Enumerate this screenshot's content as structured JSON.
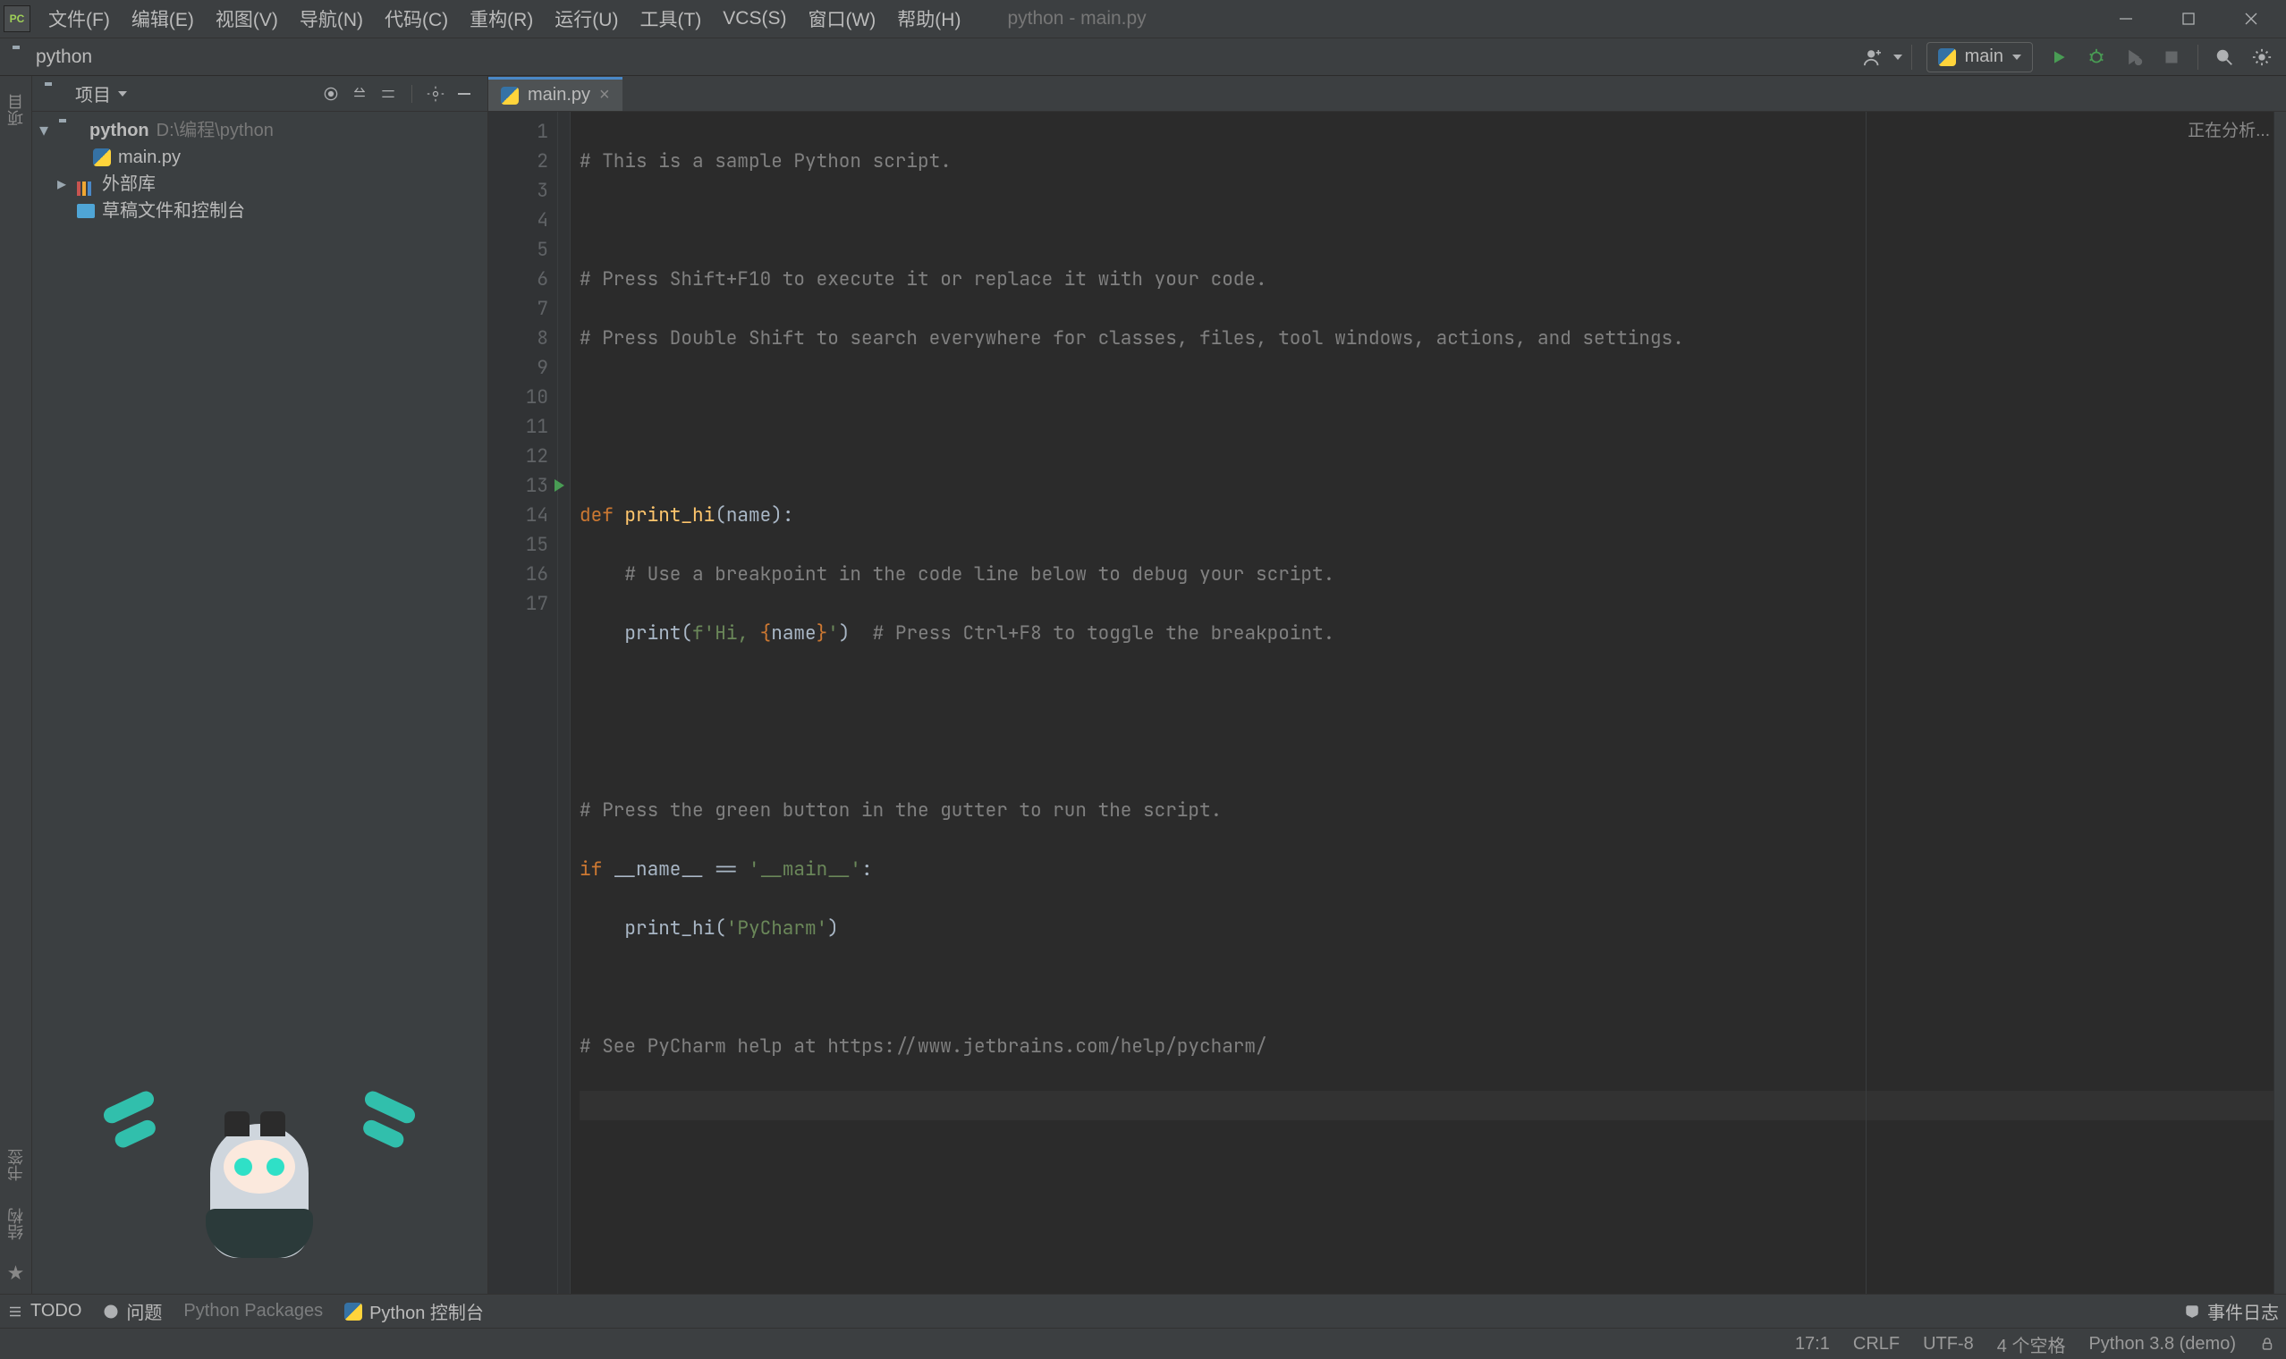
{
  "title_text": "python - main.py",
  "menu": {
    "file": "文件(F)",
    "edit": "编辑(E)",
    "view": "视图(V)",
    "nav": "导航(N)",
    "code": "代码(C)",
    "refactor": "重构(R)",
    "run": "运行(U)",
    "tools": "工具(T)",
    "vcs": "VCS(S)",
    "window": "窗口(W)",
    "help": "帮助(H)"
  },
  "nav": {
    "project_name": "python",
    "run_config_name": "main"
  },
  "tool": {
    "project_label": "项目"
  },
  "tree": {
    "project_root": "python",
    "project_path": "D:\\编程\\python",
    "main_file": "main.py",
    "ext_libs": "外部库",
    "scratches": "草稿文件和控制台"
  },
  "left_gutter": {
    "project": "项目",
    "bookmarks": "书签",
    "structure": "结构"
  },
  "tab": {
    "main": "main.py"
  },
  "code": {
    "l1_cmt": "# This is a sample Python script.",
    "l3_cmt": "# Press Shift+F10 to execute it or replace it with your code.",
    "l4_cmt": "# Press Double Shift to search everywhere for classes, files, tool windows, actions, and settings.",
    "l7_def": "def ",
    "l7_fn": "print_hi",
    "l7_rest": "(name):",
    "l8_cmt": "    # Use a breakpoint in the code line below to debug your script.",
    "l9_indent": "    ",
    "l9_print": "print",
    "l9_open": "(",
    "l9_fpre": "f'Hi, ",
    "l9_lb": "{",
    "l9_name": "name",
    "l9_rb": "}",
    "l9_fend": "'",
    "l9_close": ")",
    "l9_trailcmt": "  # Press Ctrl+F8 to toggle the breakpoint.",
    "l12_cmt": "# Press the green button in the gutter to run the script.",
    "l13_if": "if ",
    "l13_name": "__name__ == ",
    "l13_str": "'__main__'",
    "l13_colon": ":",
    "l14_indent": "    print_hi(",
    "l14_str": "'PyCharm'",
    "l14_close": ")",
    "l16_cmt": "# See PyCharm help at https://www.jetbrains.com/help/pycharm/"
  },
  "analysis_text": "正在分析...",
  "bottom": {
    "todo": "TODO",
    "problems": "问题",
    "python_packages": "Python Packages",
    "python_console": "Python 控制台",
    "event_log": "事件日志"
  },
  "status": {
    "pos": "17:1",
    "line_sep": "CRLF",
    "encoding": "UTF-8",
    "indent": "4 个空格",
    "interpreter": "Python 3.8 (demo)"
  }
}
